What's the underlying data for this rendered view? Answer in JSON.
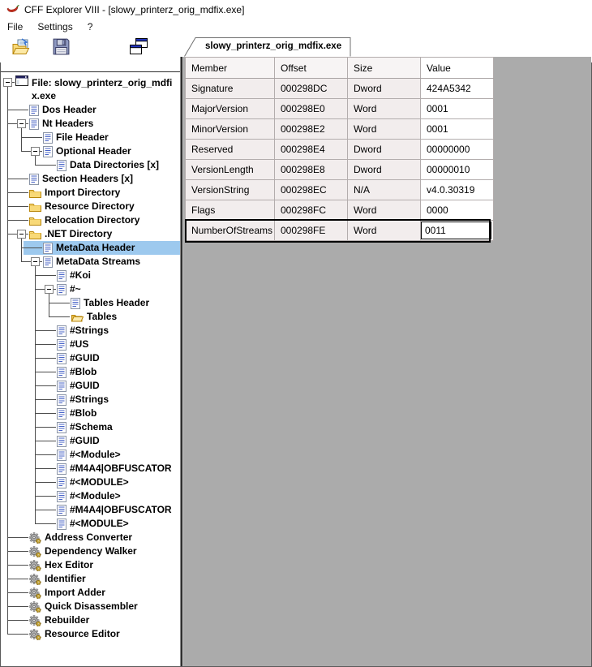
{
  "window": {
    "title": "CFF Explorer VIII - [slowy_printerz_orig_mdfix.exe]"
  },
  "menu": {
    "items": [
      "File",
      "Settings",
      "?"
    ]
  },
  "toolbar": {
    "buttons": [
      {
        "name": "open-file-button",
        "icon": "open-folder-icon"
      },
      {
        "name": "save-file-button",
        "icon": "save-floppy-icon"
      },
      {
        "name": "windows-button",
        "icon": "overlapping-windows-icon"
      }
    ]
  },
  "tab": {
    "label": "slowy_printerz_orig_mdfix.exe"
  },
  "tree": {
    "nodes": [
      {
        "label": "File: slowy_printerz_orig_mdfix.exe",
        "icon": "window",
        "prefix": [
          "r"
        ],
        "root": true
      },
      {
        "label": "Dos Header",
        "icon": "doc",
        "prefix": [
          "t",
          "h"
        ]
      },
      {
        "label": "Nt Headers",
        "icon": "doc",
        "prefix": [
          "t",
          "m"
        ]
      },
      {
        "label": "File Header",
        "icon": "doc",
        "prefix": [
          "v",
          "t",
          "h"
        ]
      },
      {
        "label": "Optional Header",
        "icon": "doc",
        "prefix": [
          "v",
          "l",
          "m"
        ]
      },
      {
        "label": "Data Directories [x]",
        "icon": "doc",
        "prefix": [
          "v",
          "e",
          "l",
          "h"
        ]
      },
      {
        "label": "Section Headers [x]",
        "icon": "doc",
        "prefix": [
          "t",
          "h"
        ]
      },
      {
        "label": "Import Directory",
        "icon": "folder",
        "prefix": [
          "t",
          "h"
        ]
      },
      {
        "label": "Resource Directory",
        "icon": "folder",
        "prefix": [
          "t",
          "h"
        ]
      },
      {
        "label": "Relocation Directory",
        "icon": "folder",
        "prefix": [
          "t",
          "h"
        ]
      },
      {
        "label": ".NET Directory",
        "icon": "folder",
        "prefix": [
          "t",
          "m"
        ]
      },
      {
        "label": "MetaData Header",
        "icon": "doc",
        "prefix": [
          "v",
          "t",
          "h"
        ],
        "selected": true
      },
      {
        "label": "MetaData Streams",
        "icon": "doc",
        "prefix": [
          "v",
          "l",
          "m"
        ]
      },
      {
        "label": "#Koi",
        "icon": "doc",
        "prefix": [
          "v",
          "e",
          "t",
          "h"
        ]
      },
      {
        "label": "#~",
        "icon": "doc",
        "prefix": [
          "v",
          "e",
          "t",
          "m"
        ]
      },
      {
        "label": "Tables Header",
        "icon": "doc",
        "prefix": [
          "v",
          "e",
          "v",
          "t",
          "h"
        ]
      },
      {
        "label": "Tables",
        "icon": "folder-open",
        "prefix": [
          "v",
          "e",
          "v",
          "l",
          "h"
        ]
      },
      {
        "label": "#Strings",
        "icon": "doc",
        "prefix": [
          "v",
          "e",
          "t",
          "h"
        ]
      },
      {
        "label": "#US",
        "icon": "doc",
        "prefix": [
          "v",
          "e",
          "t",
          "h"
        ]
      },
      {
        "label": "#GUID",
        "icon": "doc",
        "prefix": [
          "v",
          "e",
          "t",
          "h"
        ]
      },
      {
        "label": "#Blob",
        "icon": "doc",
        "prefix": [
          "v",
          "e",
          "t",
          "h"
        ]
      },
      {
        "label": "#GUID",
        "icon": "doc",
        "prefix": [
          "v",
          "e",
          "t",
          "h"
        ]
      },
      {
        "label": "#Strings",
        "icon": "doc",
        "prefix": [
          "v",
          "e",
          "t",
          "h"
        ]
      },
      {
        "label": "#Blob",
        "icon": "doc",
        "prefix": [
          "v",
          "e",
          "t",
          "h"
        ]
      },
      {
        "label": "#Schema",
        "icon": "doc",
        "prefix": [
          "v",
          "e",
          "t",
          "h"
        ]
      },
      {
        "label": "#GUID",
        "icon": "doc",
        "prefix": [
          "v",
          "e",
          "t",
          "h"
        ]
      },
      {
        "label": "#<Module>",
        "icon": "doc",
        "prefix": [
          "v",
          "e",
          "t",
          "h"
        ]
      },
      {
        "label": "#M4A4|OBFUSCATOR",
        "icon": "doc",
        "prefix": [
          "v",
          "e",
          "t",
          "h"
        ]
      },
      {
        "label": "#<MODULE>",
        "icon": "doc",
        "prefix": [
          "v",
          "e",
          "t",
          "h"
        ]
      },
      {
        "label": "#<Module>",
        "icon": "doc",
        "prefix": [
          "v",
          "e",
          "t",
          "h"
        ]
      },
      {
        "label": "#M4A4|OBFUSCATOR",
        "icon": "doc",
        "prefix": [
          "v",
          "e",
          "t",
          "h"
        ]
      },
      {
        "label": "#<MODULE>",
        "icon": "doc",
        "prefix": [
          "v",
          "e",
          "l",
          "h"
        ]
      },
      {
        "label": "Address Converter",
        "icon": "gear",
        "prefix": [
          "t",
          "h"
        ]
      },
      {
        "label": "Dependency Walker",
        "icon": "gear",
        "prefix": [
          "t",
          "h"
        ]
      },
      {
        "label": "Hex Editor",
        "icon": "gear",
        "prefix": [
          "t",
          "h"
        ]
      },
      {
        "label": "Identifier",
        "icon": "gear",
        "prefix": [
          "t",
          "h"
        ]
      },
      {
        "label": "Import Adder",
        "icon": "gear",
        "prefix": [
          "t",
          "h"
        ]
      },
      {
        "label": "Quick Disassembler",
        "icon": "gear",
        "prefix": [
          "t",
          "h"
        ]
      },
      {
        "label": "Rebuilder",
        "icon": "gear",
        "prefix": [
          "t",
          "h"
        ]
      },
      {
        "label": "Resource Editor",
        "icon": "gear",
        "prefix": [
          "l",
          "h"
        ]
      }
    ]
  },
  "table": {
    "columns": [
      "Member",
      "Offset",
      "Size",
      "Value"
    ],
    "rows": [
      {
        "member": "Signature",
        "offset": "000298DC",
        "size": "Dword",
        "value": "424A5342"
      },
      {
        "member": "MajorVersion",
        "offset": "000298E0",
        "size": "Word",
        "value": "0001"
      },
      {
        "member": "MinorVersion",
        "offset": "000298E2",
        "size": "Word",
        "value": "0001"
      },
      {
        "member": "Reserved",
        "offset": "000298E4",
        "size": "Dword",
        "value": "00000000"
      },
      {
        "member": "VersionLength",
        "offset": "000298E8",
        "size": "Dword",
        "value": "00000010"
      },
      {
        "member": "VersionString",
        "offset": "000298EC",
        "size": "N/A",
        "value": "v4.0.30319"
      },
      {
        "member": "Flags",
        "offset": "000298FC",
        "size": "Word",
        "value": "0000"
      },
      {
        "member": "NumberOfStreams",
        "offset": "000298FE",
        "size": "Word",
        "value": "0011",
        "selected": true,
        "editing": true
      }
    ]
  },
  "colors": {
    "selection_blue": "#9dc9ee",
    "panel_gray": "#ababab",
    "row_tint": "#f2eded",
    "grid_border": "#b3adad",
    "pepper_red": "#c93020",
    "folder_yellow": "#f8d978"
  }
}
